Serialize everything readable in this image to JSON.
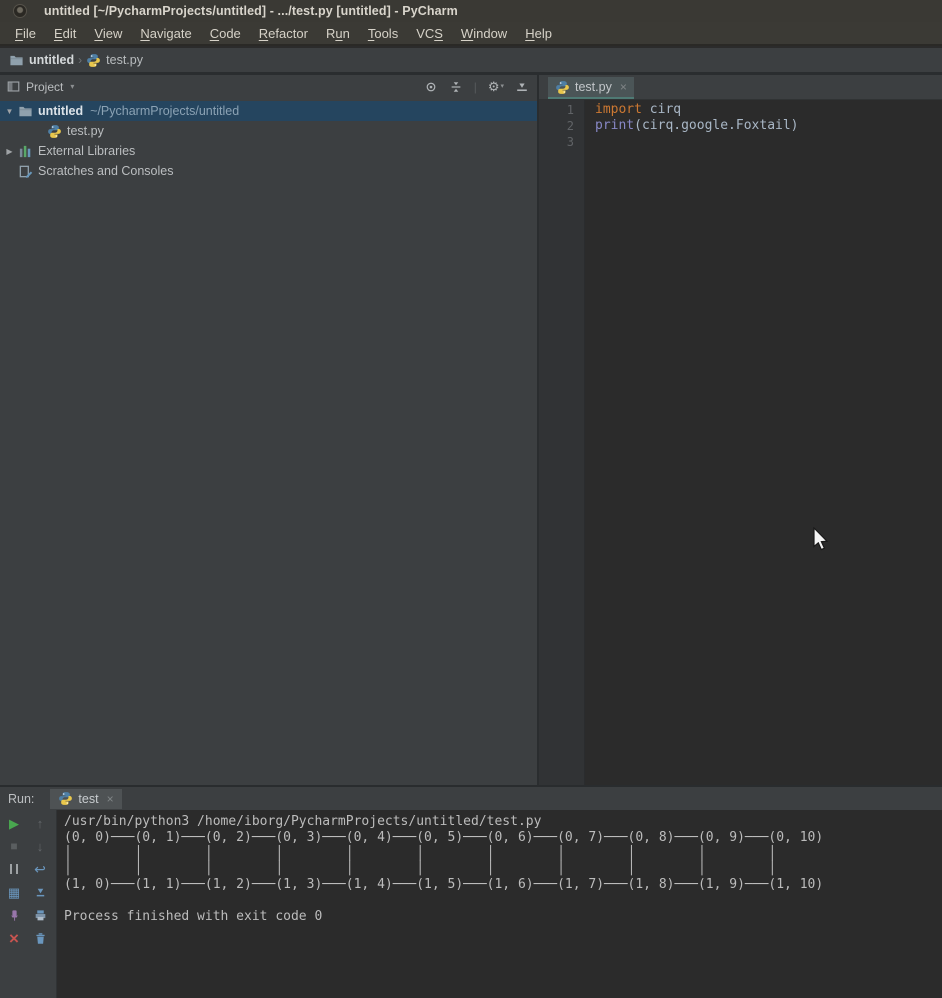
{
  "window": {
    "title": "untitled [~/PycharmProjects/untitled] - .../test.py [untitled] - PyCharm"
  },
  "menubar": {
    "items": [
      {
        "label": "File",
        "mnemonic": 0
      },
      {
        "label": "Edit",
        "mnemonic": 0
      },
      {
        "label": "View",
        "mnemonic": 0
      },
      {
        "label": "Navigate",
        "mnemonic": 0
      },
      {
        "label": "Code",
        "mnemonic": 0
      },
      {
        "label": "Refactor",
        "mnemonic": 0
      },
      {
        "label": "Run",
        "mnemonic": 1
      },
      {
        "label": "Tools",
        "mnemonic": 0
      },
      {
        "label": "VCS",
        "mnemonic": 2
      },
      {
        "label": "Window",
        "mnemonic": 0
      },
      {
        "label": "Help",
        "mnemonic": 0
      }
    ]
  },
  "breadcrumbs": {
    "separator": "›",
    "items": [
      {
        "label": "untitled",
        "icon": "folder-icon"
      },
      {
        "label": "test.py",
        "icon": "python-icon"
      }
    ]
  },
  "project_panel": {
    "title": "Project",
    "caret": "▾",
    "toolbar": [
      {
        "name": "locate-file-icon"
      },
      {
        "name": "collapse-all-icon"
      },
      {
        "name": "separator"
      },
      {
        "name": "settings-gear-icon"
      },
      {
        "name": "hide-panel-icon"
      }
    ],
    "tree": [
      {
        "label": "untitled",
        "suffix": "~/PycharmProjects/untitled",
        "icon": "folder-icon",
        "chevron": "▼",
        "selected": true,
        "bold": true,
        "indent": 0
      },
      {
        "label": "test.py",
        "suffix": "",
        "icon": "python-icon",
        "chevron": "",
        "selected": false,
        "bold": false,
        "indent": 1
      },
      {
        "label": "External Libraries",
        "suffix": "",
        "icon": "libraries-icon",
        "chevron": "▶",
        "selected": false,
        "bold": false,
        "indent": 0
      },
      {
        "label": "Scratches and Consoles",
        "suffix": "",
        "icon": "scratches-icon",
        "chevron": "",
        "selected": false,
        "bold": false,
        "indent": 0
      }
    ]
  },
  "editor": {
    "tab": {
      "label": "test.py",
      "icon": "python-icon",
      "close": "×"
    },
    "lines": [
      {
        "number": "1",
        "tokens": [
          {
            "t": "import",
            "c": "keyword"
          },
          {
            "t": " cirq",
            "c": "plain"
          }
        ]
      },
      {
        "number": "2",
        "tokens": [
          {
            "t": "print",
            "c": "builtin"
          },
          {
            "t": "(cirq.google.Foxtail)",
            "c": "plain"
          }
        ]
      },
      {
        "number": "3",
        "tokens": []
      }
    ]
  },
  "run_panel": {
    "label": "Run:",
    "tab": {
      "label": "test",
      "icon": "python-icon",
      "close": "×"
    },
    "toolbar_left": [
      {
        "name": "rerun-button"
      },
      {
        "name": "stop-button"
      },
      {
        "name": "pause-output-button"
      },
      {
        "name": "restore-layout-button"
      },
      {
        "name": "pin-tab-button"
      },
      {
        "name": "close-button"
      }
    ],
    "toolbar_right": [
      {
        "name": "up-stack-trace-button"
      },
      {
        "name": "down-stack-trace-button"
      },
      {
        "name": "soft-wrap-button"
      },
      {
        "name": "scroll-to-end-button"
      },
      {
        "name": "print-button"
      },
      {
        "name": "clear-all-button"
      }
    ],
    "console": [
      "/usr/bin/python3 /home/iborg/PycharmProjects/untitled/test.py",
      "(0, 0)───(0, 1)───(0, 2)───(0, 3)───(0, 4)───(0, 5)───(0, 6)───(0, 7)───(0, 8)───(0, 9)───(0, 10)",
      "│        │        │        │        │        │        │        │        │        │        │",
      "│        │        │        │        │        │        │        │        │        │        │",
      "(1, 0)───(1, 1)───(1, 2)───(1, 3)───(1, 4)───(1, 5)───(1, 6)───(1, 7)───(1, 8)───(1, 9)───(1, 10)",
      "",
      "Process finished with exit code 0"
    ]
  },
  "theme": {
    "syntax_keyword": "#cc7832",
    "syntax_builtin": "#8888c6",
    "syntax_plain": "#a9b7c6",
    "run_green": "#49a74f",
    "close_red": "#c75450",
    "action_blue": "#6a96bd",
    "pin_purple": "#9876aa",
    "selection_blue": "#25455f"
  }
}
